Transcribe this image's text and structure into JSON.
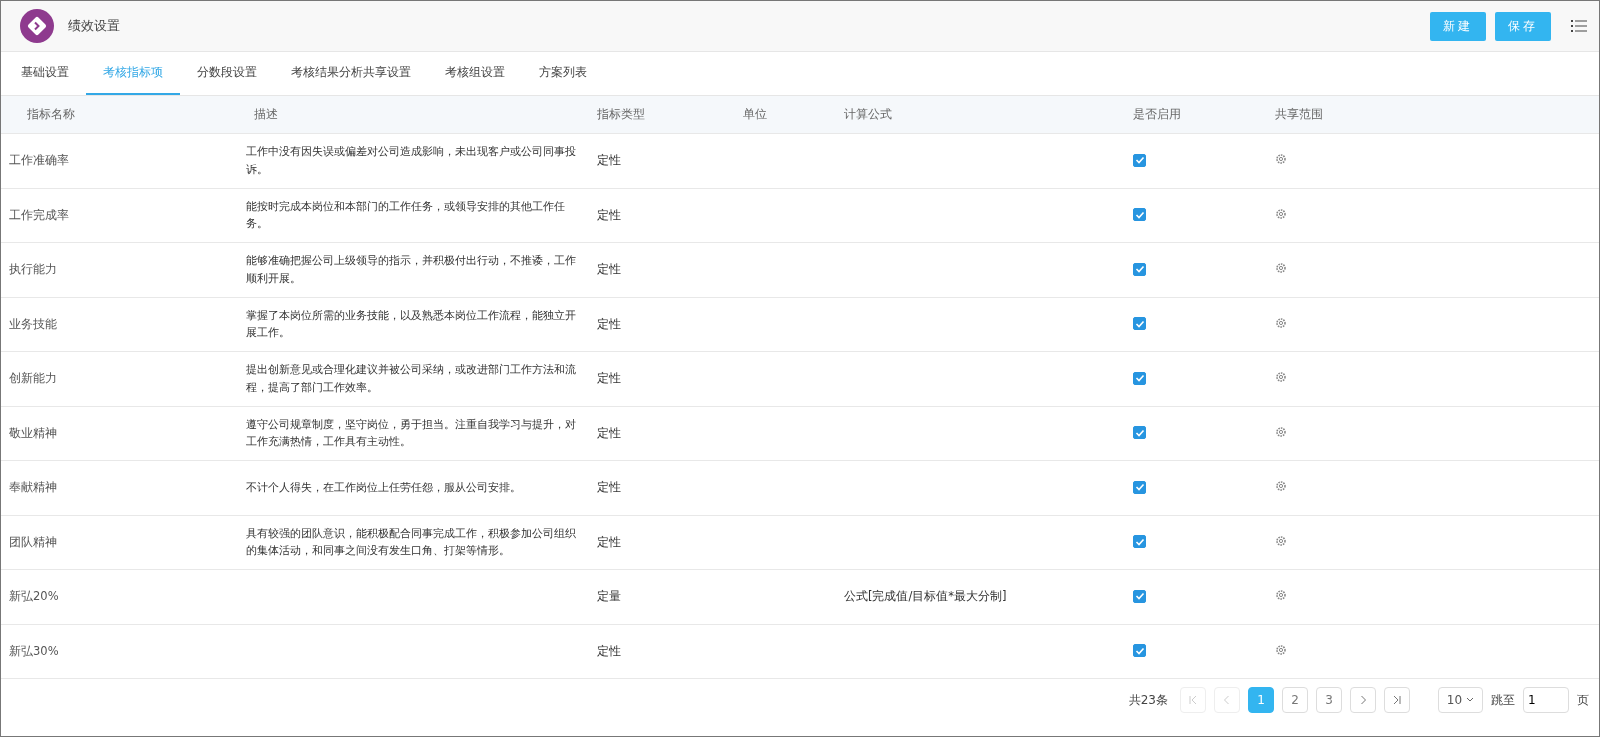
{
  "header": {
    "title": "绩效设置",
    "buttons": [
      "新建",
      "保存"
    ]
  },
  "tabs": [
    {
      "label": "基础设置",
      "selected": false
    },
    {
      "label": "考核指标项",
      "selected": true
    },
    {
      "label": "分数段设置",
      "selected": false
    },
    {
      "label": "考核结果分析共享设置",
      "selected": false
    },
    {
      "label": "考核组设置",
      "selected": false
    },
    {
      "label": "方案列表",
      "selected": false
    }
  ],
  "table": {
    "columns": [
      "指标名称",
      "描述",
      "指标类型",
      "单位",
      "计算公式",
      "是否启用",
      "共享范围"
    ],
    "rows": [
      {
        "name": "工作准确率",
        "description": "工作中没有因失误或偏差对公司造成影响，未出现客户或公司同事投诉。",
        "type": "定性",
        "unit": "",
        "formula": "",
        "enabled": true
      },
      {
        "name": "工作完成率",
        "description": "能按时完成本岗位和本部门的工作任务，或领导安排的其他工作任务。",
        "type": "定性",
        "unit": "",
        "formula": "",
        "enabled": true
      },
      {
        "name": "执行能力",
        "description": "能够准确把握公司上级领导的指示，并积极付出行动，不推诿，工作顺利开展。",
        "type": "定性",
        "unit": "",
        "formula": "",
        "enabled": true
      },
      {
        "name": "业务技能",
        "description": "掌握了本岗位所需的业务技能，以及熟悉本岗位工作流程，能独立开展工作。",
        "type": "定性",
        "unit": "",
        "formula": "",
        "enabled": true
      },
      {
        "name": "创新能力",
        "description": "提出创新意见或合理化建议并被公司采纳，或改进部门工作方法和流程，提高了部门工作效率。",
        "type": "定性",
        "unit": "",
        "formula": "",
        "enabled": true
      },
      {
        "name": "敬业精神",
        "description": "遵守公司规章制度，坚守岗位，勇于担当。注重自我学习与提升，对工作充满热情，工作具有主动性。",
        "type": "定性",
        "unit": "",
        "formula": "",
        "enabled": true
      },
      {
        "name": "奉献精神",
        "description": "不计个人得失，在工作岗位上任劳任怨，服从公司安排。",
        "type": "定性",
        "unit": "",
        "formula": "",
        "enabled": true
      },
      {
        "name": "团队精神",
        "description": "具有较强的团队意识，能积极配合同事完成工作，积极参加公司组织的集体活动，和同事之间没有发生口角、打架等情形。",
        "type": "定性",
        "unit": "",
        "formula": "",
        "enabled": true
      },
      {
        "name": "新弘20%",
        "description": "",
        "type": "定量",
        "unit": "",
        "formula": "公式[完成值/目标值*最大分制]",
        "enabled": true
      },
      {
        "name": "新弘30%",
        "description": "",
        "type": "定性",
        "unit": "",
        "formula": "",
        "enabled": true
      }
    ]
  },
  "pagination": {
    "total": "共23条",
    "first_disabled": true,
    "prev_disabled": true,
    "next_disabled": false,
    "last_disabled": false,
    "pages": [
      {
        "label": "1",
        "selected": true
      },
      {
        "label": "2",
        "selected": false
      },
      {
        "label": "3",
        "selected": false
      }
    ],
    "page_size": "10",
    "jump_label": "跳至",
    "jump_value": "1",
    "page_unit": "页"
  }
}
